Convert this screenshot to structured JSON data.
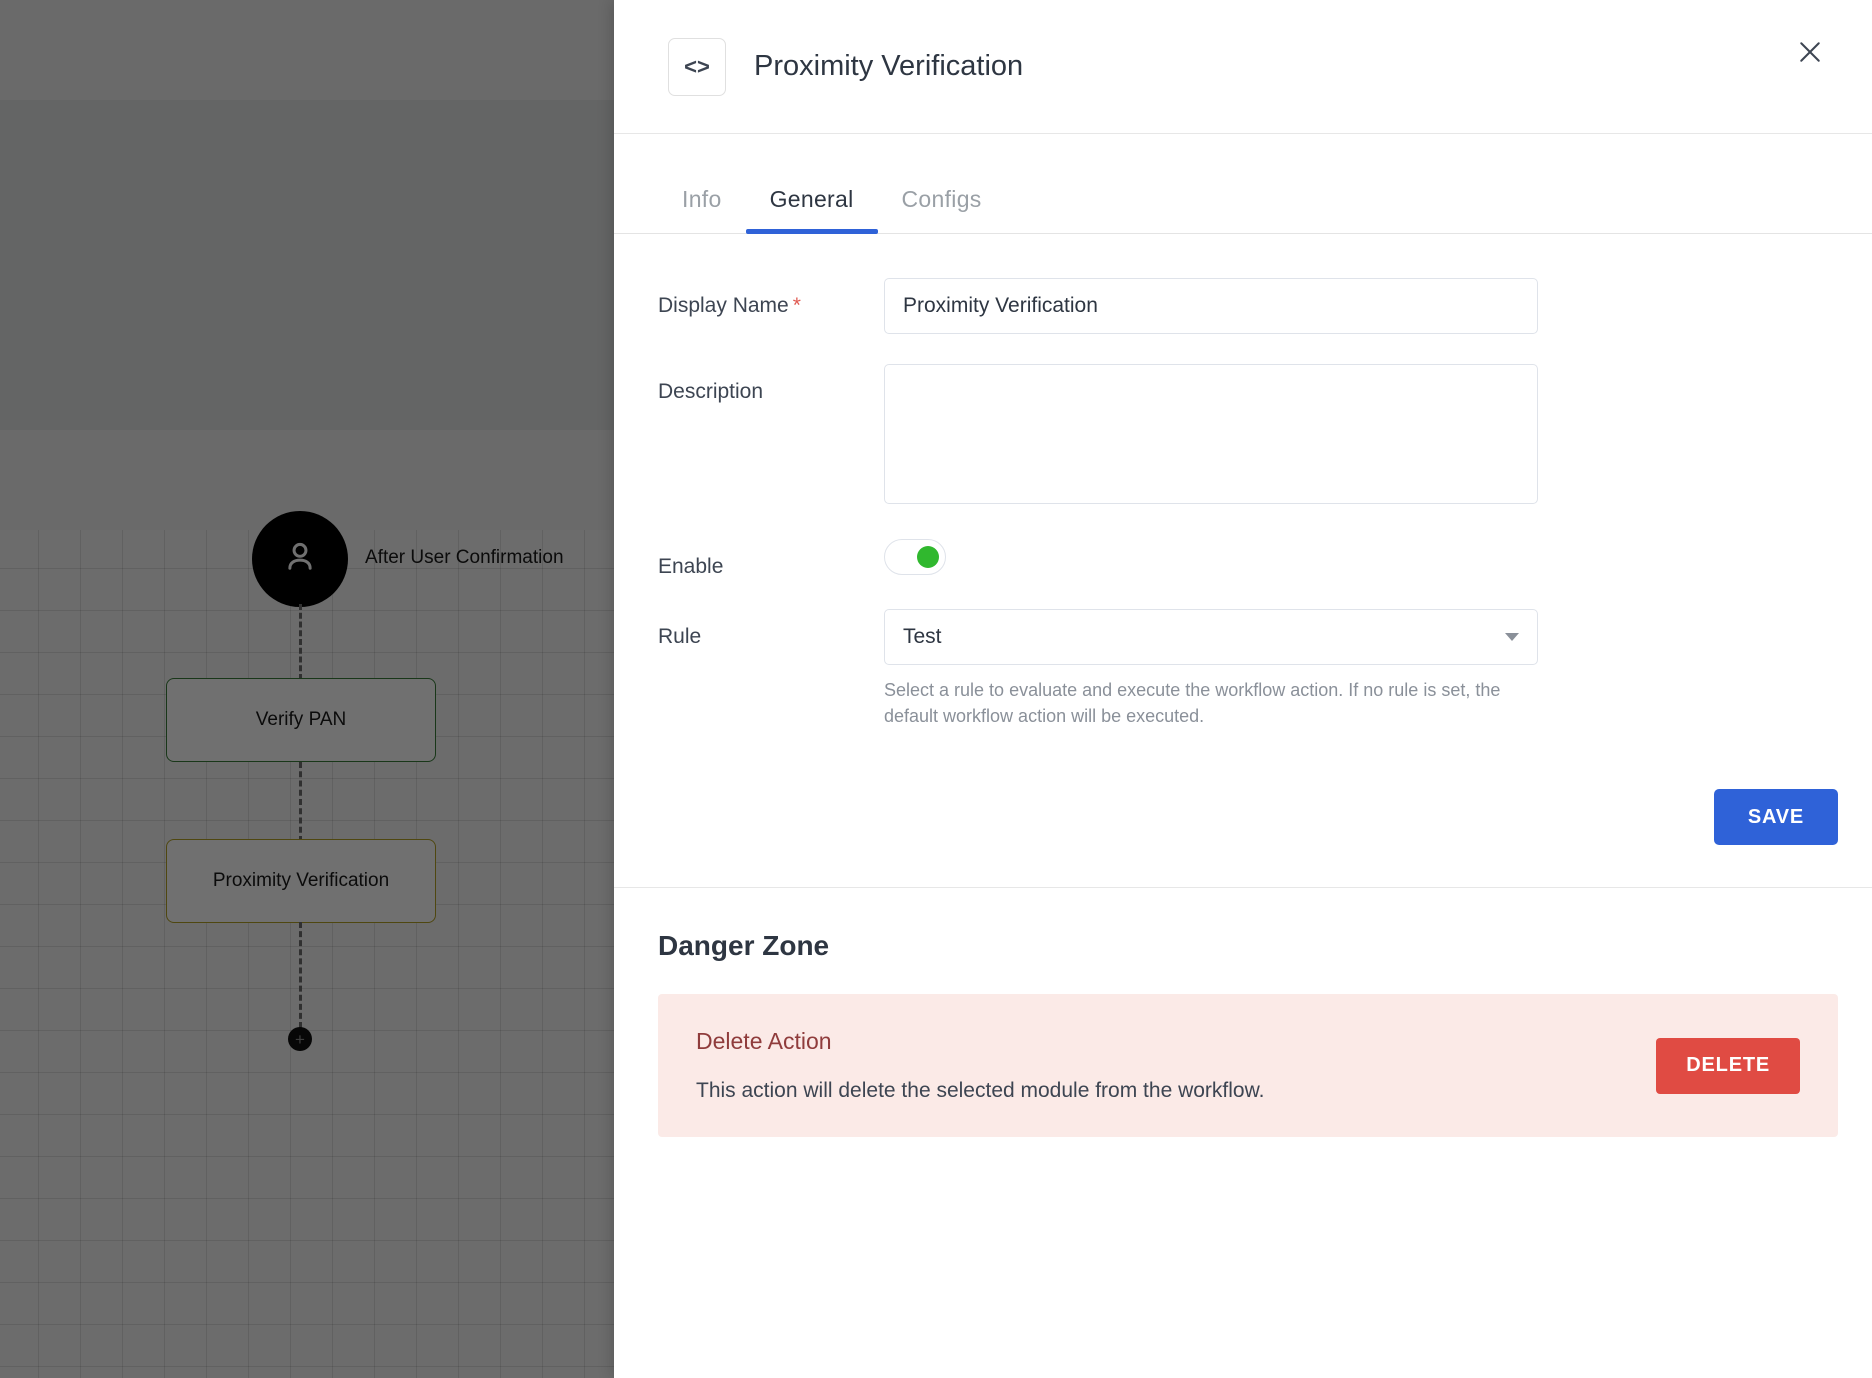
{
  "canvas": {
    "trigger": {
      "icon": "user-icon",
      "label": "After User Confirmation"
    },
    "nodes": [
      {
        "label": "Verify PAN",
        "border_color": "#3a7d3a"
      },
      {
        "label": "Proximity Verification",
        "border_color": "#b3a125"
      }
    ],
    "add_node": {
      "icon": "plus-icon",
      "label": "+"
    }
  },
  "panel": {
    "badge_icon": "code-brackets-icon",
    "badge_glyph": "<>",
    "title": "Proximity Verification",
    "close_icon": "close-icon",
    "tabs": [
      {
        "label": "Info",
        "active": false
      },
      {
        "label": "General",
        "active": true
      },
      {
        "label": "Configs",
        "active": false
      }
    ],
    "accent_color": "#2f62d8",
    "form": {
      "display_name": {
        "label": "Display Name",
        "required_marker": "*",
        "value": "Proximity Verification",
        "placeholder": ""
      },
      "description": {
        "label": "Description",
        "value": "",
        "placeholder": ""
      },
      "enable": {
        "label": "Enable",
        "state": "on"
      },
      "rule": {
        "label": "Rule",
        "value": "Test",
        "caret_icon": "chevron-down-icon",
        "helper": "Select a rule to evaluate and execute the workflow action. If no rule is set, the default workflow action will be executed."
      },
      "save_label": "SAVE"
    },
    "danger": {
      "title": "Danger Zone",
      "heading": "Delete Action",
      "description": "This action will delete the selected module from the workflow.",
      "delete_label": "DELETE",
      "delete_color": "#e04b43",
      "box_color": "#fbeae7"
    }
  }
}
